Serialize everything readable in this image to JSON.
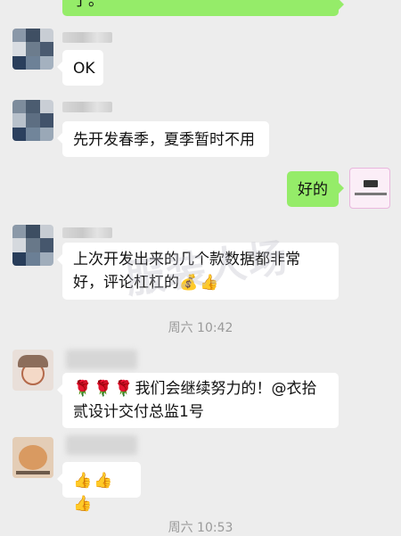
{
  "messages": {
    "m0": {
      "text": "了。"
    },
    "m1": {
      "text": "OK"
    },
    "m2": {
      "text": "先开发春季，夏季暂时不用"
    },
    "m3": {
      "text": "好的"
    },
    "m4": {
      "line1": "上次开发出来的几个款数据都非常",
      "line2": "好，评论杠杠的"
    },
    "t1": {
      "text": "周六 10:42"
    },
    "m5": {
      "line1": "我们会继续努力的！@衣拾",
      "line2": "贰设计交付总监1号"
    },
    "m6": {
      "text": ""
    },
    "t2": {
      "text": "周六 10:53"
    }
  },
  "emojis": {
    "rose": "🌹",
    "thumbs_up": "👍",
    "moneybag": "💰"
  },
  "watermark": "服装人场",
  "colors": {
    "background": "#ededed",
    "sent_bubble": "#95ec69",
    "received_bubble": "#ffffff",
    "timestamp": "#9a9a9a"
  }
}
